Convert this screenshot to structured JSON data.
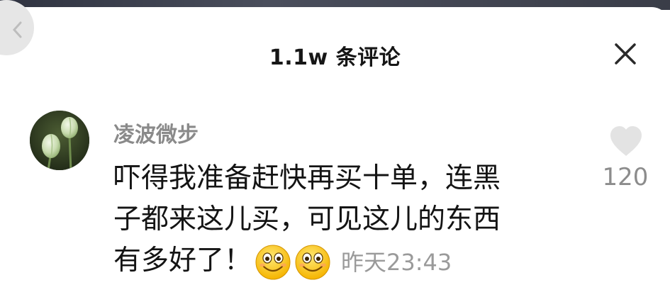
{
  "header": {
    "title": "1.1w 条评论",
    "close_icon": "close-icon",
    "back_icon": "chevron-left-icon"
  },
  "comment": {
    "username": "凌波微步",
    "avatar_icon": "lotus-bud-avatar",
    "text_lines": [
      "吓得我准备赶快再买十单，连黑",
      "子都来这儿买，可见这儿的东西",
      "有多好了！"
    ],
    "emojis": [
      "grinning-face-emoji",
      "grinning-face-emoji"
    ],
    "timestamp": "昨天23:43",
    "like_icon": "heart-icon",
    "like_count": "120"
  }
}
